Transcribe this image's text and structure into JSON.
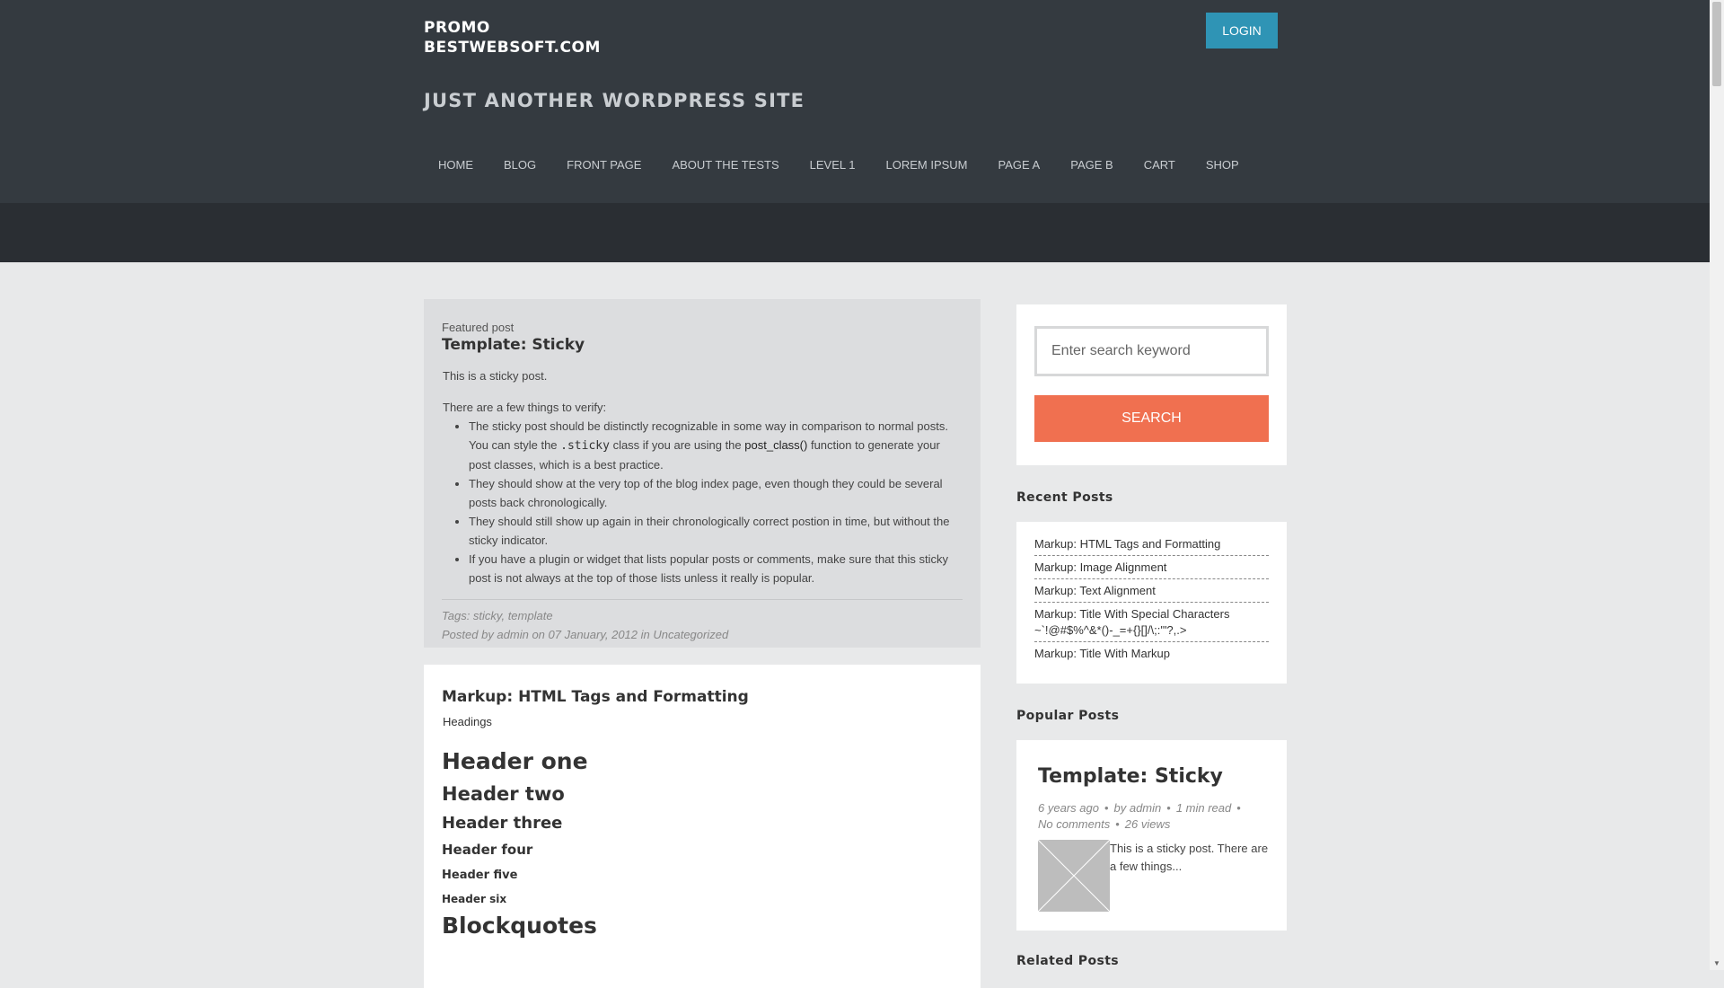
{
  "header": {
    "logo_line1": "PROMO",
    "logo_line2": "BESTWEBSOFT.COM",
    "login": "LOGIN",
    "tagline": "JUST ANOTHER WORDPRESS SITE",
    "nav": [
      "HOME",
      "BLOG",
      "FRONT PAGE",
      "ABOUT THE TESTS",
      "LEVEL 1",
      "LOREM IPSUM",
      "PAGE A",
      "PAGE B",
      "CART",
      "SHOP"
    ]
  },
  "sticky_post": {
    "featured": "Featured post",
    "title": "Template: Sticky",
    "intro": "This is a sticky post.",
    "verify": "There are a few things to verify:",
    "bullet1_a": "The sticky post should be distinctly recognizable in some way in comparison to normal posts. You can style the ",
    "bullet1_code": ".sticky",
    "bullet1_b": " class if you are using the ",
    "bullet1_fn": "post_class()",
    "bullet1_c": " function to generate your post classes, which is a best practice.",
    "bullet2": "They should show at the very top of the blog index page, even though they could be several posts back chronologically.",
    "bullet3": "They should still show up again in their chronologically correct postion in time, but without the sticky indicator.",
    "bullet4": "If you have a plugin or widget that lists popular posts or comments, make sure that this sticky post is not always at the top of those lists unless it really is popular.",
    "tags": "Tags: sticky, template",
    "posted": "Posted by admin on 07 January, 2012 in Uncategorized"
  },
  "markup_post": {
    "title": "Markup: HTML Tags and Formatting",
    "subheading": "Headings",
    "h1": "Header one",
    "h2": "Header two",
    "h3": "Header three",
    "h4": "Header four",
    "h5": "Header five",
    "h6": "Header six",
    "next": "Blockquotes"
  },
  "sidebar": {
    "search_placeholder": "Enter search keyword",
    "search_button": "SEARCH",
    "recent_title": "Recent Posts",
    "recent": [
      "Markup: HTML Tags and Formatting",
      "Markup: Image Alignment",
      "Markup: Text Alignment",
      "Markup: Title With Special Characters ~`!@#$%^&*()-_=+{}[]/\\;:'\"?,.>",
      "Markup: Title With Markup"
    ],
    "popular_title": "Popular Posts",
    "popular": {
      "title": "Template: Sticky",
      "age": "6 years ago",
      "author": "by admin",
      "read": "1 min read",
      "comments": "No comments",
      "views": "26 views",
      "excerpt": "This is a sticky post. There are a few things..."
    },
    "related_title": "Related Posts"
  },
  "colors": {
    "header_bg": "#343a40",
    "accent_login": "#2f94b5",
    "accent_search": "#f07050"
  }
}
